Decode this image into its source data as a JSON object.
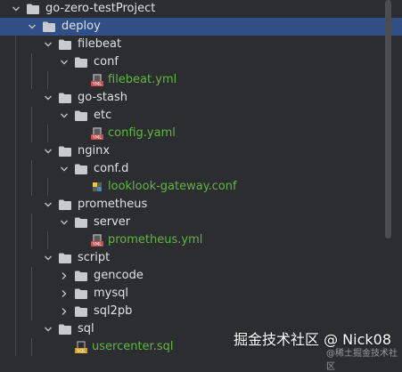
{
  "tree": [
    {
      "label": "go-zero-testProject",
      "depth": 0,
      "kind": "folder",
      "expanded": true,
      "selected": false
    },
    {
      "label": "deploy",
      "depth": 1,
      "kind": "folder",
      "expanded": true,
      "selected": true
    },
    {
      "label": "filebeat",
      "depth": 2,
      "kind": "folder",
      "expanded": true
    },
    {
      "label": "conf",
      "depth": 3,
      "kind": "folder",
      "expanded": true
    },
    {
      "label": "filebeat.yml",
      "depth": 4,
      "kind": "yml"
    },
    {
      "label": "go-stash",
      "depth": 2,
      "kind": "folder",
      "expanded": true
    },
    {
      "label": "etc",
      "depth": 3,
      "kind": "folder",
      "expanded": true
    },
    {
      "label": "config.yaml",
      "depth": 4,
      "kind": "yml"
    },
    {
      "label": "nginx",
      "depth": 2,
      "kind": "folder",
      "expanded": true
    },
    {
      "label": "conf.d",
      "depth": 3,
      "kind": "folder",
      "expanded": true
    },
    {
      "label": "looklook-gateway.conf",
      "depth": 4,
      "kind": "conf"
    },
    {
      "label": "prometheus",
      "depth": 2,
      "kind": "folder",
      "expanded": true
    },
    {
      "label": "server",
      "depth": 3,
      "kind": "folder",
      "expanded": true
    },
    {
      "label": "prometheus.yml",
      "depth": 4,
      "kind": "yml"
    },
    {
      "label": "script",
      "depth": 2,
      "kind": "folder",
      "expanded": true
    },
    {
      "label": "gencode",
      "depth": 3,
      "kind": "folder",
      "expanded": false
    },
    {
      "label": "mysql",
      "depth": 3,
      "kind": "folder",
      "expanded": false
    },
    {
      "label": "sql2pb",
      "depth": 3,
      "kind": "folder",
      "expanded": false
    },
    {
      "label": "sql",
      "depth": 2,
      "kind": "folder",
      "expanded": true
    },
    {
      "label": "usercenter.sql",
      "depth": 3,
      "kind": "sql"
    }
  ],
  "watermark": {
    "main": "掘金技术社区 @ Nick08",
    "sub": "@稀土掘金技术社区"
  },
  "colors": {
    "background": "#2b2d30",
    "selected_row": "#2f4f86",
    "file_text": "#62b543"
  }
}
